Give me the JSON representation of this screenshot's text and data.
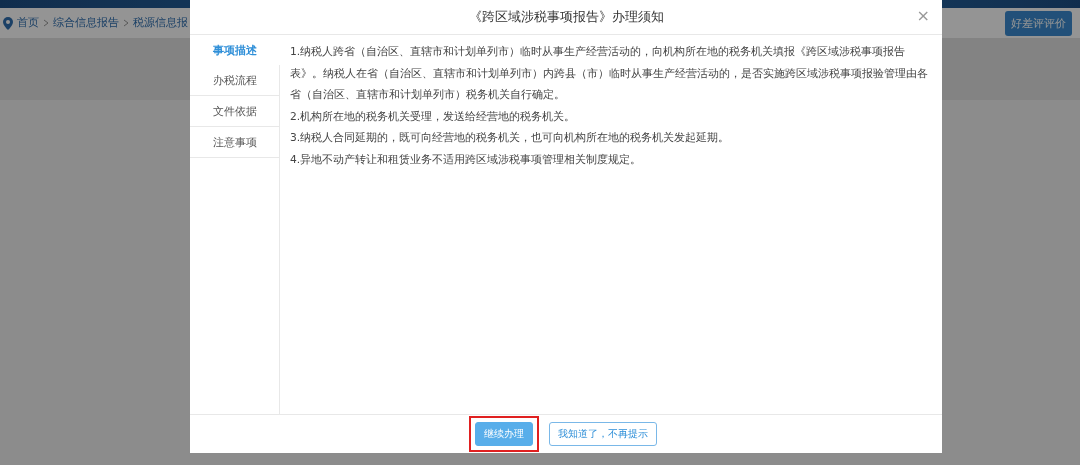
{
  "breadcrumb": [
    {
      "label": "首页"
    },
    {
      "label": "综合信息报告"
    },
    {
      "label": "税源信息报"
    }
  ],
  "review_button": "好差评评价",
  "dialog": {
    "title": "《跨区域涉税事项报告》办理须知",
    "close": "×",
    "tabs": [
      {
        "label": "事项描述",
        "selected": true
      },
      {
        "label": "办税流程",
        "selected": false
      },
      {
        "label": "文件依据",
        "selected": false
      },
      {
        "label": "注意事项",
        "selected": false
      }
    ],
    "paragraphs": [
      " 1.纳税人跨省（自治区、直辖市和计划单列市）临时从事生产经营活动的，向机构所在地的税务机关填报《跨区域涉税事项报告表》。纳税人在省（自治区、直辖市和计划单列市）内跨县（市）临时从事生产经营活动的，是否实施跨区域涉税事项报验管理由各省（自治区、直辖市和计划单列市）税务机关自行确定。",
      "2.机构所在地的税务机关受理，发送给经营地的税务机关。",
      "3.纳税人合同延期的，既可向经营地的税务机关，也可向机构所在地的税务机关发起延期。",
      "4.异地不动产转让和租赁业务不适用跨区域涉税事项管理相关制度规定。"
    ],
    "buttons": [
      {
        "label": "继续办理",
        "kind": "primary",
        "highlighted": true
      },
      {
        "label": "我知道了，不再提示",
        "kind": "plain",
        "highlighted": false
      }
    ]
  }
}
